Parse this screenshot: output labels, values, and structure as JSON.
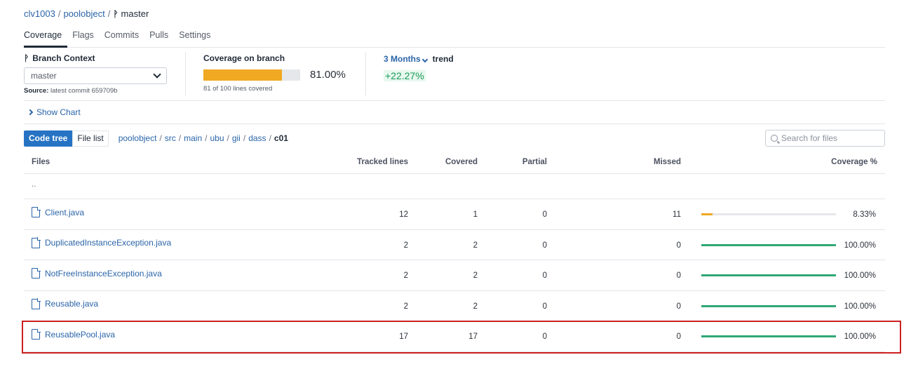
{
  "breadcrumb": {
    "owner": "clv1003",
    "repo": "poolobject",
    "branch": "master"
  },
  "tabs": [
    {
      "label": "Coverage",
      "active": true
    },
    {
      "label": "Flags",
      "active": false
    },
    {
      "label": "Commits",
      "active": false
    },
    {
      "label": "Pulls",
      "active": false
    },
    {
      "label": "Settings",
      "active": false
    }
  ],
  "branch_context": {
    "title": "Branch Context",
    "selected": "master",
    "source_label": "Source:",
    "source_text": "latest commit 659709b"
  },
  "coverage_on_branch": {
    "title": "Coverage on branch",
    "percent_text": "81.00%",
    "percent": 81,
    "subtext": "81 of 100 lines covered",
    "color": "#f0a922"
  },
  "trend": {
    "period": "3 Months",
    "label": "trend",
    "value": "+22.27%"
  },
  "show_chart": "Show Chart",
  "toolbar": {
    "code_tree": "Code tree",
    "file_list": "File list",
    "path": [
      "poolobject",
      "src",
      "main",
      "ubu",
      "gii",
      "dass"
    ],
    "current": "c01",
    "search_placeholder": "Search for files"
  },
  "table": {
    "headers": {
      "files": "Files",
      "tracked": "Tracked lines",
      "covered": "Covered",
      "partial": "Partial",
      "missed": "Missed",
      "coverage": "Coverage %"
    },
    "parent": "..",
    "rows": [
      {
        "name": "Client.java",
        "tracked": "12",
        "covered": "1",
        "partial": "0",
        "missed": "11",
        "coverage": "8.33%",
        "fraction": 0.0833,
        "color": "#f0a922"
      },
      {
        "name": "DuplicatedInstanceException.java",
        "tracked": "2",
        "covered": "2",
        "partial": "0",
        "missed": "0",
        "coverage": "100.00%",
        "fraction": 1,
        "color": "#2fa876"
      },
      {
        "name": "NotFreeInstanceException.java",
        "tracked": "2",
        "covered": "2",
        "partial": "0",
        "missed": "0",
        "coverage": "100.00%",
        "fraction": 1,
        "color": "#2fa876"
      },
      {
        "name": "Reusable.java",
        "tracked": "2",
        "covered": "2",
        "partial": "0",
        "missed": "0",
        "coverage": "100.00%",
        "fraction": 1,
        "color": "#2fa876"
      },
      {
        "name": "ReusablePool.java",
        "tracked": "17",
        "covered": "17",
        "partial": "0",
        "missed": "0",
        "coverage": "100.00%",
        "fraction": 1,
        "color": "#2fa876"
      }
    ]
  },
  "highlight_color": "#cc1f1f"
}
